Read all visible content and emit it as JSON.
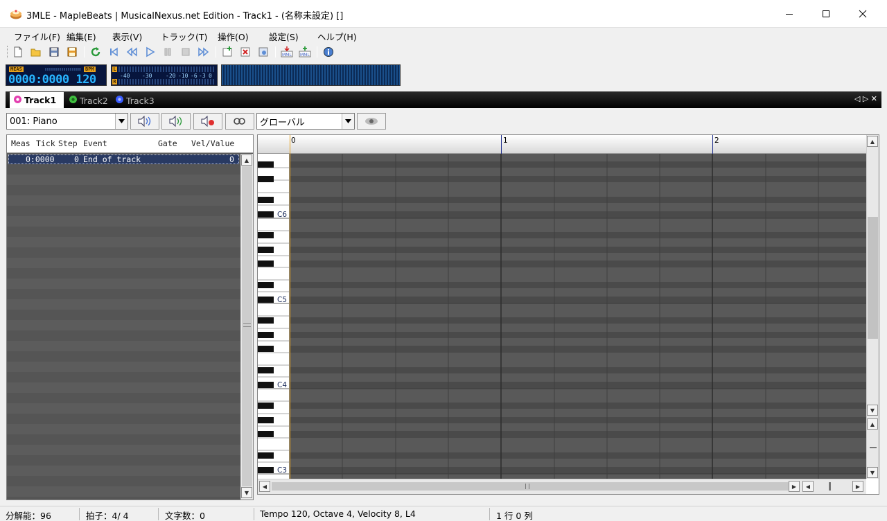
{
  "window": {
    "title": "3MLE - MapleBeats | MusicalNexus.net Edition - Track1 - (名称未設定) []",
    "icon": "maple-cake-icon"
  },
  "menu": [
    "ファイル(F)",
    "編集(E)",
    "表示(V)",
    "トラック(T)",
    "操作(O)",
    "設定(S)",
    "ヘルプ(H)"
  ],
  "toolbar": {
    "icons": [
      "new-file-icon",
      "open-folder-icon",
      "save-icon",
      "save-as-icon",
      "reload-icon",
      "skip-start-icon",
      "rewind-icon",
      "play-icon",
      "pause-icon",
      "stop-icon",
      "fast-forward-icon",
      "add-track-icon",
      "delete-track-icon",
      "track-settings-icon",
      "mml-import-icon",
      "mml-add-icon",
      "info-icon"
    ]
  },
  "display": {
    "meas_label": "MEAS",
    "bpm_label": "BPM",
    "meas_value": "0000:0000",
    "bpm_value": "120",
    "level_channels": [
      "L",
      "R"
    ],
    "level_scale": [
      "-40",
      "-30",
      "-20",
      "-10",
      "-6",
      "-3",
      "0"
    ]
  },
  "tabs": [
    {
      "label": "Track1",
      "active": true,
      "color": "#e33fb0"
    },
    {
      "label": "Track2",
      "active": false,
      "color": "#40c040"
    },
    {
      "label": "Track3",
      "active": false,
      "color": "#3a5cff"
    }
  ],
  "track_controls": {
    "instrument": "001: Piano",
    "scope": "グローバル"
  },
  "event_list": {
    "columns": [
      "Meas",
      "Tick",
      "Step",
      "Event",
      "Gate",
      "Vel/Value"
    ],
    "rows": [
      {
        "meas_tick": "0:0000",
        "step": "0",
        "event": "End of track",
        "value": "0"
      }
    ]
  },
  "piano_roll": {
    "measures": [
      "0",
      "1",
      "2"
    ],
    "octave_labels": [
      "C6",
      "C5",
      "C4",
      "C3"
    ]
  },
  "status": {
    "resolution": "分解能：96",
    "time_signature": "拍子：4/ 4",
    "char_count": "文字数：0",
    "info": "Tempo 120, Octave 4, Velocity  8, L4",
    "cursor": "1 行 0 列"
  },
  "colors": {
    "accent_orange": "#e7a21d",
    "display_bg": "#07153d",
    "display_digits": "#27b4ff",
    "grid_bg": "#4d4d4d",
    "event_bg": "#5a5a5a"
  }
}
